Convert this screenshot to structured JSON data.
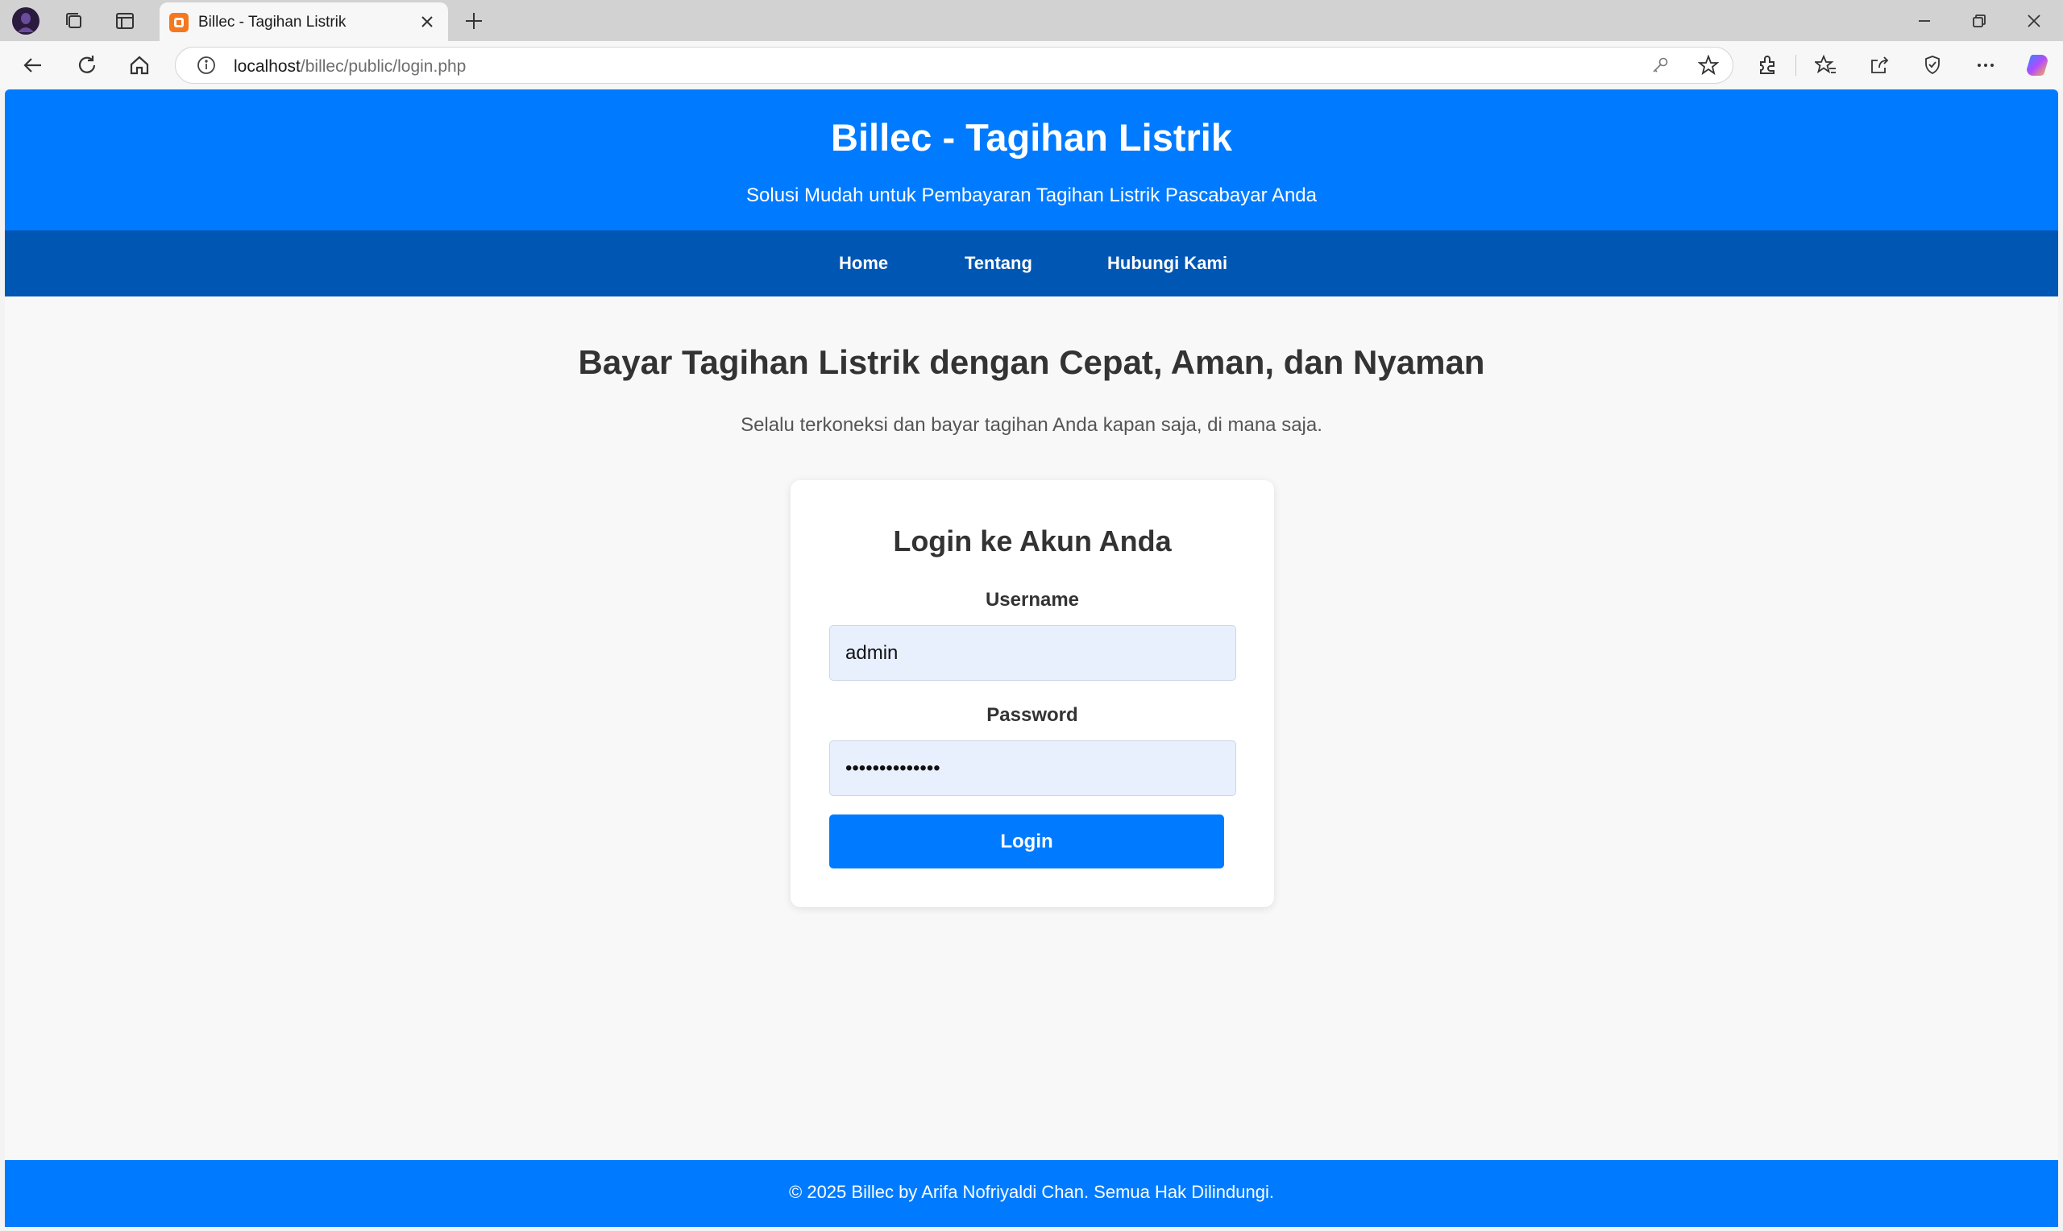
{
  "browser": {
    "tab": {
      "title": "Billec - Tagihan Listrik"
    },
    "address": {
      "host": "localhost",
      "path": "/billec/public/login.php"
    },
    "icons": [
      "profile-icon",
      "workspaces-icon",
      "tab-actions-icon",
      "new-tab-icon",
      "minimize-icon",
      "restore-icon",
      "close-icon",
      "back-icon",
      "refresh-icon",
      "home-icon",
      "site-info-icon",
      "key-icon",
      "favorite-star-icon",
      "extensions-icon",
      "favorites-icon",
      "share-icon",
      "browser-essentials-icon",
      "more-icon",
      "copilot-icon"
    ]
  },
  "header": {
    "title": "Billec - Tagihan Listrik",
    "subtitle": "Solusi Mudah untuk Pembayaran Tagihan Listrik Pascabayar Anda"
  },
  "nav": {
    "items": [
      {
        "label": "Home"
      },
      {
        "label": "Tentang"
      },
      {
        "label": "Hubungi Kami"
      }
    ]
  },
  "hero": {
    "title": "Bayar Tagihan Listrik dengan Cepat, Aman, dan Nyaman",
    "subtitle": "Selalu terkoneksi dan bayar tagihan Anda kapan saja, di mana saja."
  },
  "login": {
    "title": "Login ke Akun Anda",
    "username_label": "Username",
    "username_value": "admin",
    "password_label": "Password",
    "password_value": "adminpassword1",
    "button_label": "Login"
  },
  "footer": {
    "text": "© 2025 Billec by Arifa Nofriyaldi Chan. Semua Hak Dilindungi."
  },
  "colors": {
    "primary": "#007bff",
    "nav": "#0056b3",
    "input_bg": "#e8f0fe"
  }
}
